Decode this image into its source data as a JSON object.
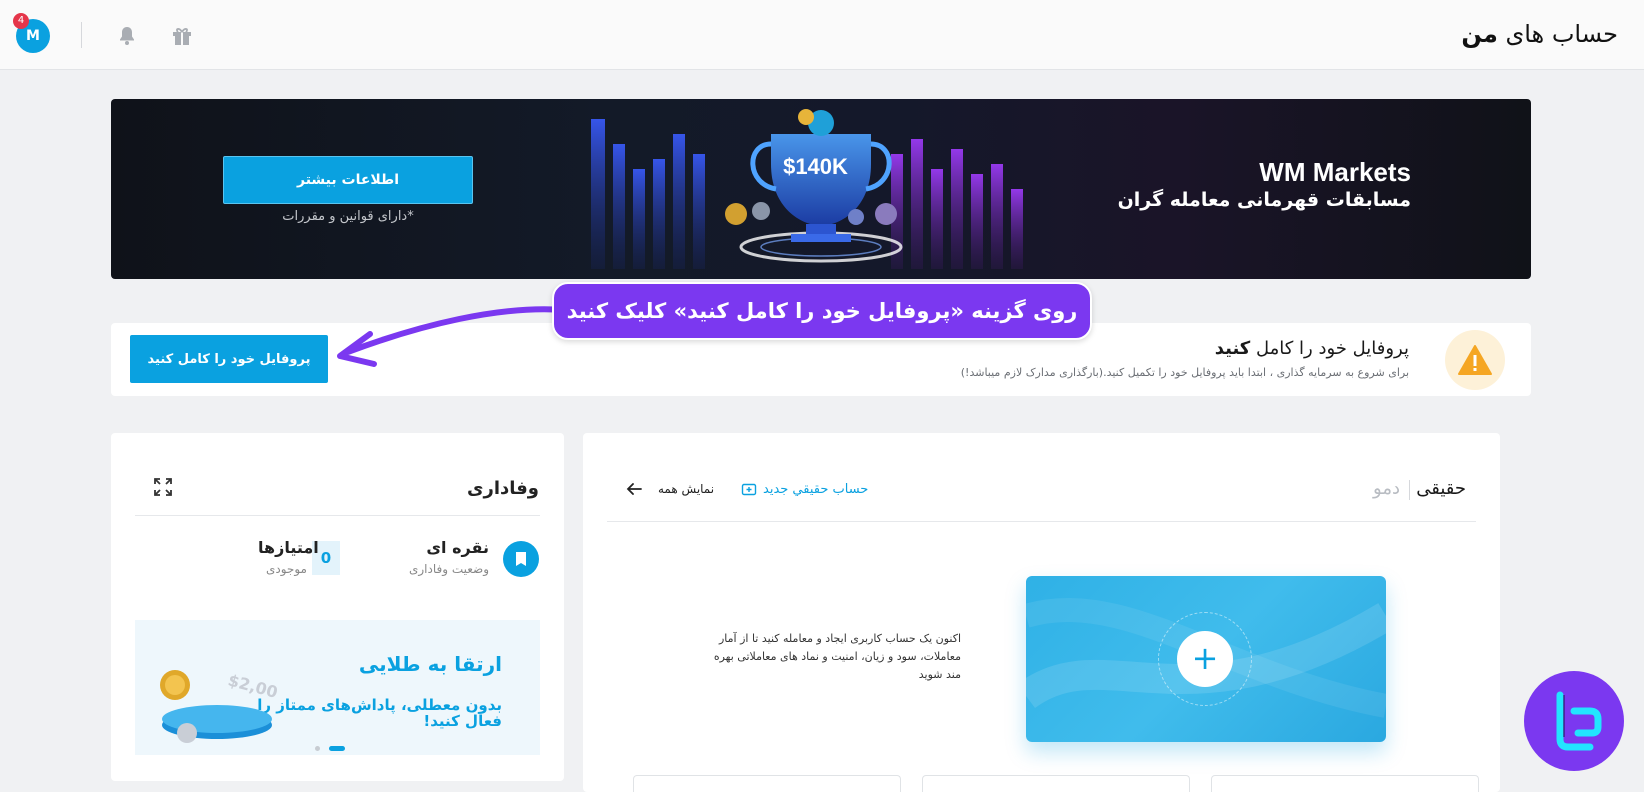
{
  "header": {
    "title_prefix": "حساب های",
    "title_bold": "من",
    "avatar_initial": "M",
    "notification_count": "4"
  },
  "banner": {
    "brand": "WM Markets",
    "subtitle": "مسابقات قهرمانی معامله گران",
    "prize": "$140K",
    "button_label": "اطلاعات بیشتر",
    "rules_note": "*دارای قوانین و مقررات"
  },
  "annotation": {
    "callout": "روی گزینه «پروفایل خود را کامل کنید» کلیک کنید"
  },
  "profile_alert": {
    "title_prefix": "پروفایل خود را کامل",
    "title_bold": "کنید",
    "description": "برای شروع به سرمایه گذاری ، ابتدا باید پروفایل خود را تکمیل کنید.(بارگذاری مدارک لازم میباشد!)",
    "button_label": "پروفایل خود را کامل کنید"
  },
  "loyalty": {
    "title": "وفاداری",
    "tier_name": "نقره ای",
    "tier_label": "وضعیت وفاداری",
    "points_value": "0",
    "points_name": "امتیازها",
    "points_label": "موجودی",
    "promo_title": "ارتقا به طلایی",
    "promo_text": "بدون معطلی، پاداش‌های ممتاز را فعال کنید!",
    "promo_amount": "$2,000"
  },
  "accounts": {
    "tab_real": "حقیقی",
    "tab_demo": "دمو",
    "new_account": "حساب حقیقي جدید",
    "show_all": "نمایش همه",
    "description": "اکنون یک حساب کاربری ایجاد و معامله کنید تا از آمار معاملات، سود و زیان، امنیت و نماد های معاملاتی بهره مند شوید",
    "create_symbol": "+"
  },
  "colors": {
    "accent": "#0aa1e0",
    "callout": "#7b38f0",
    "badge": "#e5364a",
    "warning": "#f5a623"
  }
}
